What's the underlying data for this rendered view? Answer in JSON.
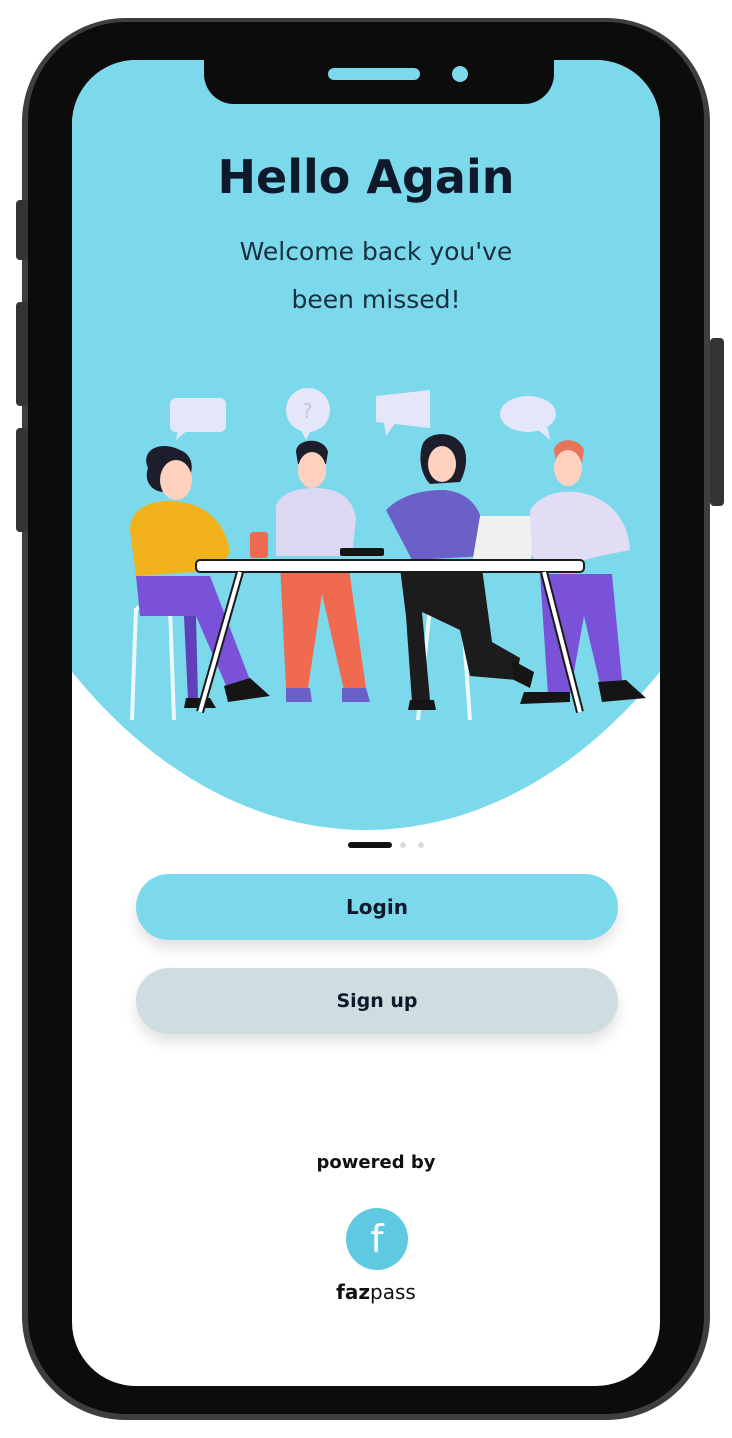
{
  "header": {
    "title": "Hello Again",
    "subtitle_line1": "Welcome back you've",
    "subtitle_line2": "been missed!"
  },
  "pager": {
    "active": 1,
    "total": 3
  },
  "actions": {
    "login_label": "Login",
    "signup_label": "Sign up"
  },
  "footer": {
    "powered_label": "powered by",
    "brand_bold": "faz",
    "brand_rest": "pass",
    "brand_glyph": "f"
  },
  "colors": {
    "accent": "#7cd8eb",
    "secondary_button": "#cfdde0",
    "text_dark": "#0e1a2b"
  },
  "icons": [
    "speech-bubble-icon",
    "question-bubble-icon",
    "megaphone-bubble-icon",
    "chat-bubble-icon",
    "fazpass-logo-icon"
  ]
}
